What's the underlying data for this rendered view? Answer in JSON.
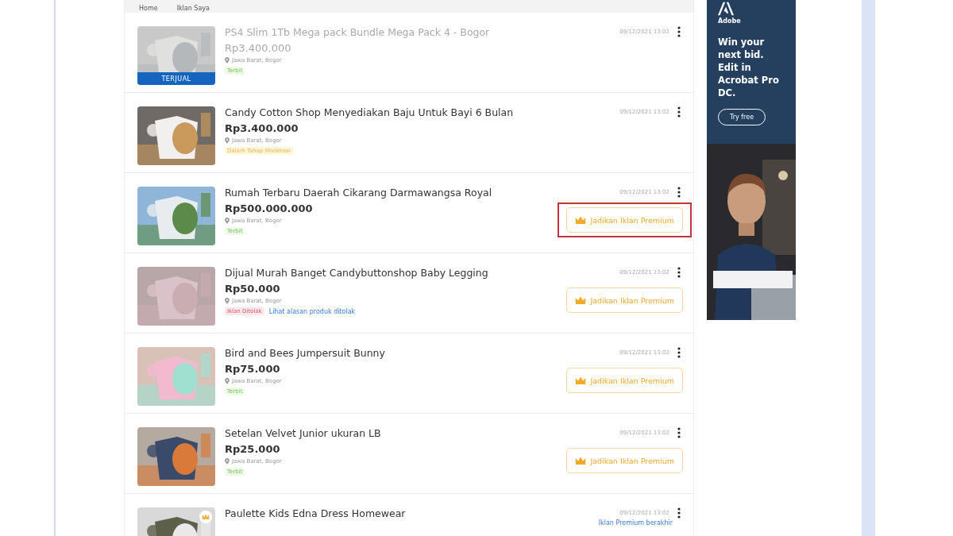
{
  "breadcrumb": [
    "Home",
    "Iklan Saya"
  ],
  "listings": [
    {
      "title": "PS4 Slim 1Tb Mega pack Bundle Mega Pack 4 - Bogor",
      "price": "Rp3.400.000",
      "location": "Jawa Barat, Bogor",
      "status": {
        "label": "Terbit",
        "kind": "published"
      },
      "date": "09/12/2021 13:02",
      "sold": true,
      "sold_label": "TERJUAL"
    },
    {
      "title": "Candy Cotton Shop Menyediakan Baju Untuk Bayi 6 Bulan",
      "price": "Rp3.400.000",
      "location": "Jawa Barat, Bogor",
      "status": {
        "label": "Dalam Tahap Moderasi",
        "kind": "moderation"
      },
      "date": "09/12/2021 13:02",
      "sold": false
    },
    {
      "title": "Rumah Terbaru Daerah Cikarang Darmawangsa Royal",
      "price": "Rp500.000.000",
      "location": "Jawa Barat, Bogor",
      "status": {
        "label": "Terbit",
        "kind": "published"
      },
      "date": "09/12/2021 13:02",
      "sold": false,
      "premium_button": "Jadikan Iklan Premium",
      "highlighted": true
    },
    {
      "title": "Dijual Murah Banget Candybuttonshop Baby Legging",
      "price": "Rp50.000",
      "location": "Jawa Barat, Bogor",
      "status": {
        "label": "Iklan Ditolak",
        "kind": "rejected"
      },
      "link": "Lihat alasan produk ditolak",
      "date": "09/12/2021 13:02",
      "sold": false,
      "premium_button": "Jadikan Iklan Premium",
      "highlighted": false
    },
    {
      "title": "Bird and Bees Jumpersuit Bunny",
      "price": "Rp75.000",
      "location": "Jawa Barat, Bogor",
      "status": {
        "label": "Terbit",
        "kind": "published"
      },
      "date": "09/12/2021 13:02",
      "sold": false,
      "premium_button": "Jadikan Iklan Premium",
      "highlighted": false
    },
    {
      "title": "Setelan Velvet Junior ukuran LB",
      "price": "Rp25.000",
      "location": "Jawa Barat, Bogor",
      "status": {
        "label": "Terbit",
        "kind": "published"
      },
      "date": "09/12/2021 13:02",
      "sold": false,
      "premium_button": "Jadikan Iklan Premium",
      "highlighted": false
    },
    {
      "title": "Paulette Kids Edna Dress Homewear",
      "date": "09/12/2021 13:02",
      "sold": false,
      "premium": true,
      "premium_note": "Iklan Premium berakhir"
    }
  ],
  "ad": {
    "brand": "Adobe",
    "headline": "Win your next bid. Edit in Acrobat Pro DC.",
    "button": "Try free"
  }
}
